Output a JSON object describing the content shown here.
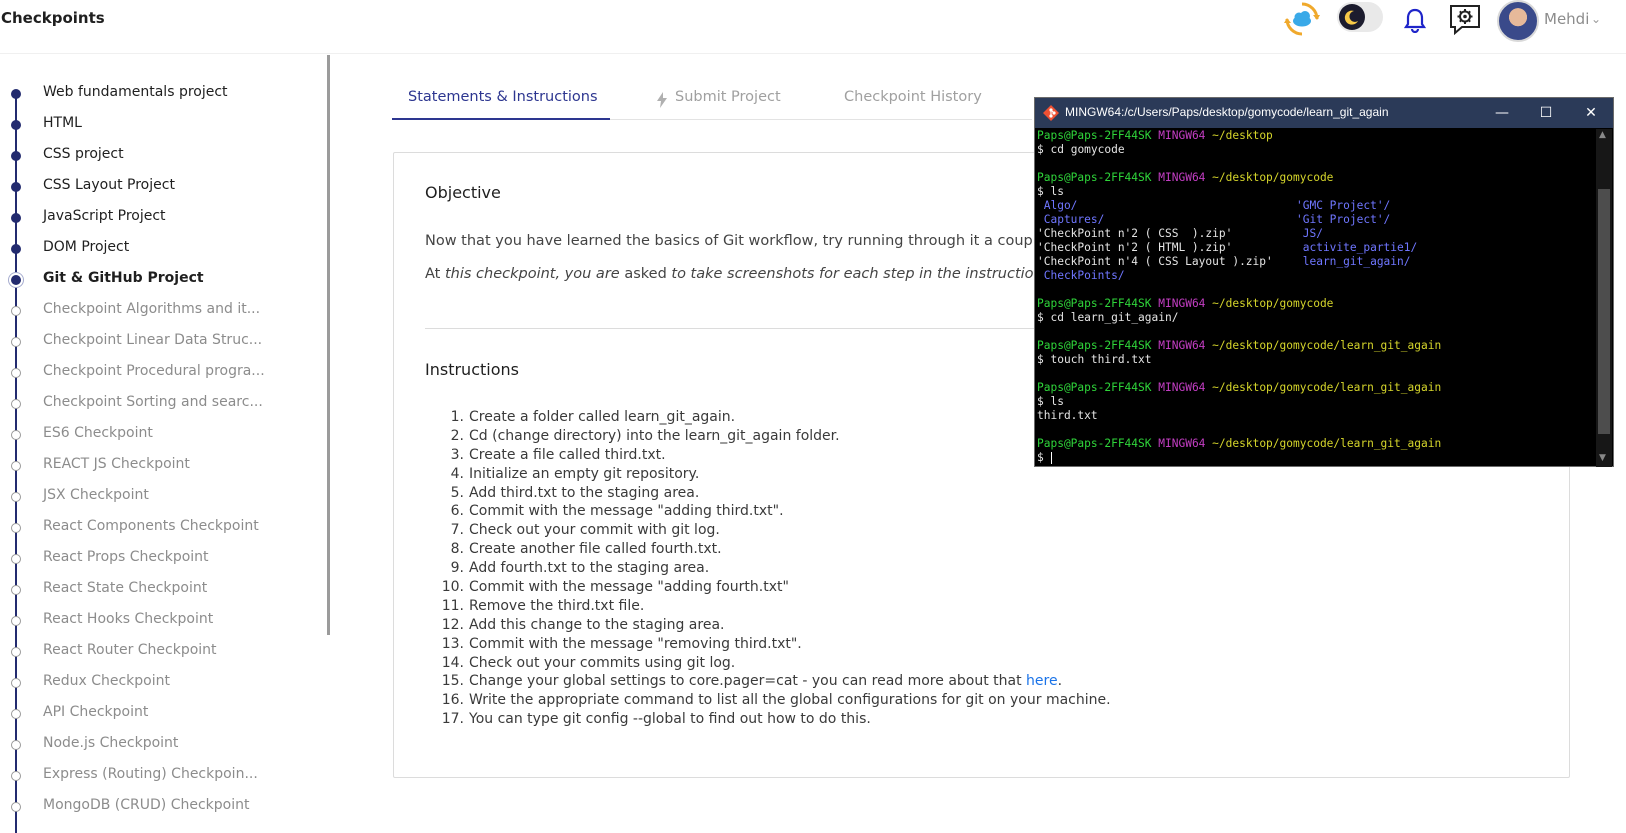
{
  "header": {
    "brand": "Checkpoints",
    "user_name": "Mehdi",
    "icons": [
      "sync-cloud-icon",
      "dark-mode-toggle",
      "bell-icon",
      "settings-chat-icon",
      "avatar"
    ]
  },
  "sidebar": {
    "items": [
      {
        "label": "Web fundamentals project",
        "state": "done"
      },
      {
        "label": "HTML",
        "state": "done"
      },
      {
        "label": "CSS project",
        "state": "done"
      },
      {
        "label": "CSS Layout Project",
        "state": "done"
      },
      {
        "label": "JavaScript Project",
        "state": "done"
      },
      {
        "label": "DOM Project",
        "state": "done"
      },
      {
        "label": "Git & GitHub Project",
        "state": "current"
      },
      {
        "label": "Checkpoint Algorithms and it...",
        "state": "todo"
      },
      {
        "label": "Checkpoint Linear Data Struc...",
        "state": "todo"
      },
      {
        "label": "Checkpoint Procedural progra...",
        "state": "todo"
      },
      {
        "label": "Checkpoint Sorting and searc...",
        "state": "todo"
      },
      {
        "label": "ES6 Checkpoint",
        "state": "todo"
      },
      {
        "label": "REACT JS Checkpoint",
        "state": "todo"
      },
      {
        "label": "JSX Checkpoint",
        "state": "todo"
      },
      {
        "label": "React Components Checkpoint",
        "state": "todo"
      },
      {
        "label": "React Props Checkpoint",
        "state": "todo"
      },
      {
        "label": "React State Checkpoint",
        "state": "todo"
      },
      {
        "label": "React Hooks Checkpoint",
        "state": "todo"
      },
      {
        "label": "React Router Checkpoint",
        "state": "todo"
      },
      {
        "label": "Redux Checkpoint",
        "state": "todo"
      },
      {
        "label": "API Checkpoint",
        "state": "todo"
      },
      {
        "label": "Node.js Checkpoint",
        "state": "todo"
      },
      {
        "label": "Express (Routing) Checkpoin...",
        "state": "todo"
      },
      {
        "label": "MongoDB (CRUD) Checkpoint",
        "state": "todo"
      }
    ]
  },
  "tabs": {
    "statements": "Statements & Instructions",
    "submit": "Submit Project",
    "history": "Checkpoint History"
  },
  "content": {
    "objective_title": "Objective",
    "objective_p1": "Now that you have learned the basics of Git workflow, try running through it a couple of",
    "objective_p2_a": "At ",
    "objective_p2_b": "this checkpoint, you are",
    "objective_p2_c": " asked ",
    "objective_p2_d": "to take screenshots for each step in the instructions s",
    "instructions_title": "Instructions",
    "steps": [
      "Create a folder called learn_git_again.",
      "Cd (change directory) into the learn_git_again folder.",
      "Create a file called third.txt.",
      "Initialize an empty git repository.",
      "Add third.txt to the staging area.",
      "Commit with the message \"adding third.txt\".",
      "Check out your commit with git log.",
      "Create another file called fourth.txt.",
      "Add fourth.txt to the staging area.",
      "Commit with the message \"adding fourth.txt\"",
      "Remove the third.txt file.",
      "Add this change to the staging area.",
      "Commit with the message \"removing third.txt\".",
      "Check out your commits using git log.",
      "Change your global settings to core.pager=cat - you can read more about that ",
      "Write the appropriate  command to list all the global configurations for git on your machine.",
      "You can type git config --global to find out how to do this."
    ],
    "step15_link": "here",
    "step15_end": "."
  },
  "terminal": {
    "title": "MINGW64:/c/Users/Paps/desktop/gomycode/learn_git_again",
    "user_host": "Paps@Paps-2FF44SK",
    "shell": "MINGW64",
    "path_desktop": "~/desktop",
    "path_gomycode": "~/desktop/gomycode",
    "path_learn": "~/desktop/gomycode/learn_git_again",
    "prompt": "$",
    "cmd1": "cd gomycode",
    "cmd2": "ls",
    "cmd3": "cd learn_git_again/",
    "cmd4": "touch third.txt",
    "cmd5": "ls",
    "ls_left": [
      " Algo/",
      " Captures/",
      "'CheckPoint n'2 ( CSS  ).zip'",
      "'CheckPoint n'2 ( HTML ).zip'",
      "'CheckPoint n'4 ( CSS Layout ).zip'",
      " CheckPoints/"
    ],
    "ls_right": [
      "'GMC Project'/",
      "'Git Project'/",
      " JS/",
      " activite_partie1/",
      " learn_git_again/",
      ""
    ],
    "ls_output": "third.txt"
  },
  "colors": {
    "primary": "#2d3690",
    "sidebar_line": "#232b6f",
    "link": "#1a73e8",
    "term_green": "#2fd53a",
    "term_magenta": "#c43ec4",
    "term_yellow": "#d5d52b",
    "term_blue": "#6f76ff"
  }
}
